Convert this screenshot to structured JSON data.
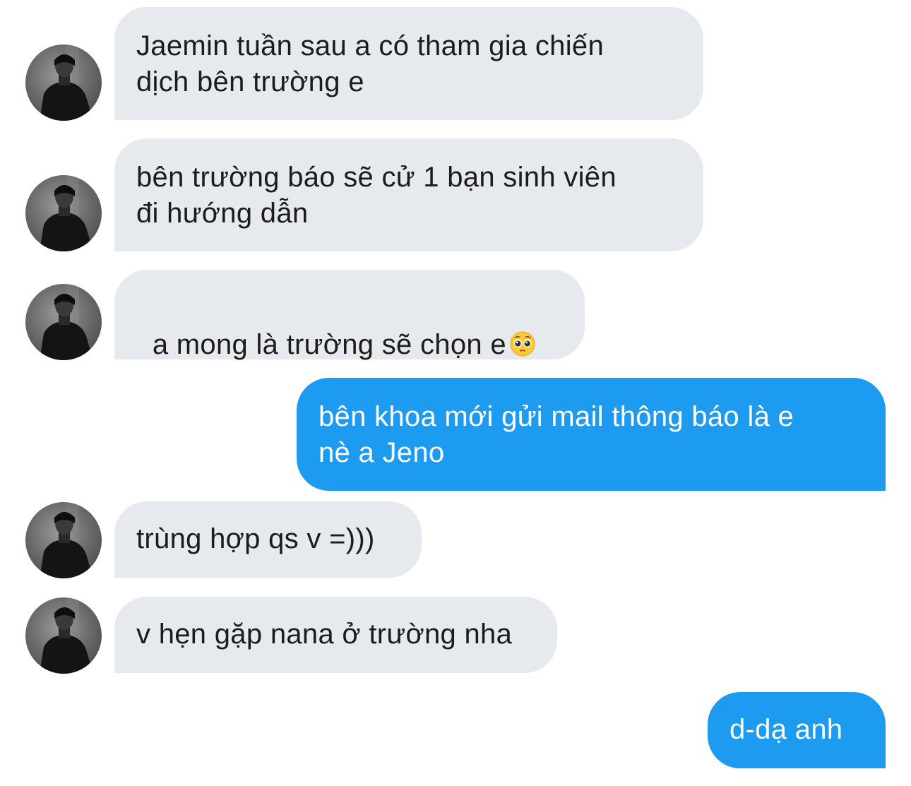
{
  "conversation": {
    "messages": [
      {
        "sender": "other",
        "text": "Jaemin tuần sau a có tham gia chiến\ndịch bên trường e"
      },
      {
        "sender": "other",
        "text": "bên trường báo sẽ cử 1 bạn sinh viên\nđi hướng dẫn"
      },
      {
        "sender": "other",
        "text": "a mong là trường sẽ chọn e",
        "emoji": "pleading-face"
      },
      {
        "sender": "me",
        "text": "bên khoa mới gửi mail thông báo là e\nnè a Jeno"
      },
      {
        "sender": "other",
        "text": "trùng hợp qs v =)))"
      },
      {
        "sender": "other",
        "text": "v hẹn gặp nana ở trường nha"
      },
      {
        "sender": "me",
        "text": "d-dạ anh"
      }
    ]
  },
  "colors": {
    "incoming_bubble": "#e6eaee",
    "outgoing_bubble": "#1d9bf0",
    "incoming_text": "#1c1c1c",
    "outgoing_text": "#ffffff"
  }
}
